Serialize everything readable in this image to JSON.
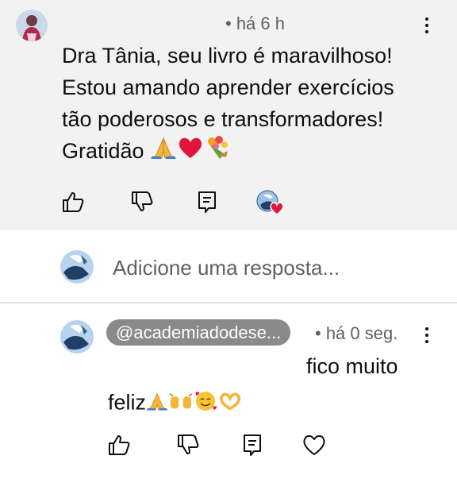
{
  "comment": {
    "timestamp": "• há 6 h",
    "text_lines": [
      "Dra Tânia, seu livro é maravilhoso!",
      "Estou amando aprender exercícios",
      "tão poderosos e transformadores!",
      "Gratidão"
    ],
    "emojis": [
      "folded-hands",
      "red-heart",
      "bouquet"
    ],
    "actions": [
      "like-icon",
      "dislike-icon",
      "reply-icon",
      "creator-heart-icon"
    ]
  },
  "reply_input": {
    "placeholder": "Adicione uma resposta..."
  },
  "reply": {
    "author_mention": "@academiadodese...",
    "timestamp": "• há 0 seg.",
    "text_line1": "fico muito",
    "text_line2": "feliz",
    "emojis": [
      "folded-hands",
      "raising-hands",
      "smiling-face-with-hearts",
      "heart-hands"
    ],
    "actions": [
      "like-icon",
      "dislike-icon",
      "reply-icon",
      "heart-icon"
    ]
  },
  "colors": {
    "comment_bg": "#f2f2f2",
    "meta_text": "#606060",
    "mention_bg": "#8a8a8a",
    "heart": "#e0143c"
  }
}
